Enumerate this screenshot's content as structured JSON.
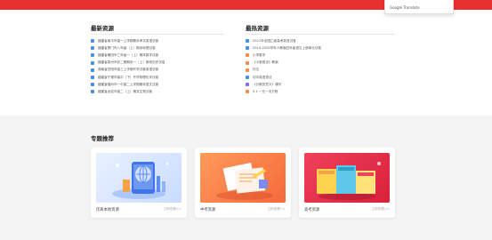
{
  "translate_popup": {
    "label": "Google Translate"
  },
  "latest": {
    "title": "最新资源",
    "items": [
      "福建省南平市高一上学期期末考试英语试卷",
      "福建省厦门市八年级（上）期末地理试卷",
      "福建省莆田市三年级一（上）期末数学试卷",
      "福建省泉州市初二期期末一（上）期末历史试卷",
      "湖南省岳阳市高三上学期开学试卷英语试卷",
      "福建省宁德市高中（下）开学物理化学试卷",
      "福建省福州市一中高二上学期期末语文试卷",
      "福建省龙岩市高二（上）期末生物试卷"
    ]
  },
  "hot": {
    "title": "最热资源",
    "items": [
      "2021年全国乙卷高考英语试卷",
      "2019-2020学年人教版四年级语文上册单元试卷",
      "小学数学",
      "《小数乘法》教案",
      "作文",
      "初中英语语法",
      "《分数的意义》课件",
      "5.1 一元一次方程"
    ]
  },
  "featured": {
    "title": "专题推荐",
    "cards": [
      {
        "name": "优质本地资源",
        "more": "立即查看>>"
      },
      {
        "name": "中考资源",
        "more": "立即查看>>"
      },
      {
        "name": "高考资源",
        "more": "立即查看>>"
      }
    ]
  },
  "colors": {
    "brand_red": "#e8312f",
    "bullet_blue": "#4a90e2",
    "bullet_orange": "#f58c4b",
    "bullet_purple": "#8a6cf0"
  },
  "hot_bullet_colors": [
    "blue",
    "blue",
    "orange",
    "orange",
    "orange",
    "blue",
    "purple",
    "orange"
  ]
}
